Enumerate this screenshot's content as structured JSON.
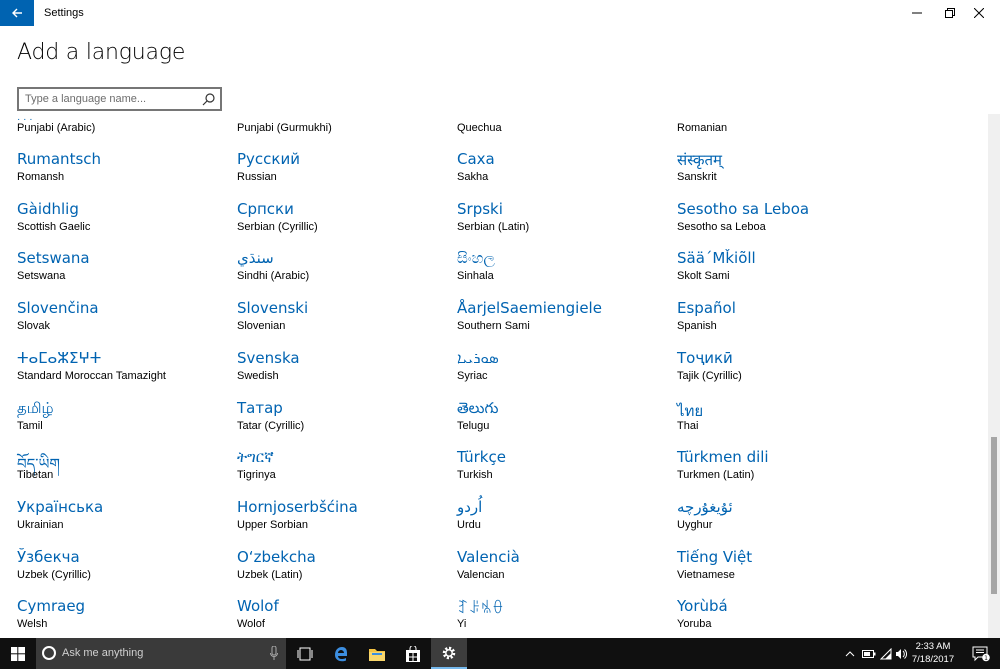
{
  "window": {
    "title": "Settings",
    "back_label": "Back",
    "minimize_label": "Minimize",
    "maximize_label": "Maximize",
    "close_label": "Close"
  },
  "page": {
    "title": "Add a language"
  },
  "search": {
    "placeholder": "Type a language name...",
    "value": ""
  },
  "languages": {
    "rows": [
      [
        {
          "native": "",
          "english": "Punjabi (Arabic)"
        },
        {
          "native": "",
          "english": "Punjabi (Gurmukhi)"
        },
        {
          "native": "",
          "english": "Quechua"
        },
        {
          "native": "",
          "english": "Romanian"
        }
      ],
      [
        {
          "native": "Rumantsch",
          "english": "Romansh"
        },
        {
          "native": "Русский",
          "english": "Russian"
        },
        {
          "native": "Саха",
          "english": "Sakha"
        },
        {
          "native": "संस्कृतम्",
          "english": "Sanskrit"
        }
      ],
      [
        {
          "native": "Gàidhlig",
          "english": "Scottish Gaelic"
        },
        {
          "native": "Српски",
          "english": "Serbian (Cyrillic)"
        },
        {
          "native": "Srpski",
          "english": "Serbian (Latin)"
        },
        {
          "native": "Sesotho sa Leboa",
          "english": "Sesotho sa Leboa"
        }
      ],
      [
        {
          "native": "Setswana",
          "english": "Setswana"
        },
        {
          "native": "سنڌي",
          "english": "Sindhi (Arabic)"
        },
        {
          "native": "සිංහල",
          "english": "Sinhala"
        },
        {
          "native": "Sää´Mǩiõll",
          "english": "Skolt Sami"
        }
      ],
      [
        {
          "native": "Slovenčina",
          "english": "Slovak"
        },
        {
          "native": "Slovenski",
          "english": "Slovenian"
        },
        {
          "native": "ÅarjelSaemiengiele",
          "english": "Southern Sami"
        },
        {
          "native": "Español",
          "english": "Spanish"
        }
      ],
      [
        {
          "native": "ⵜⴰⵎⴰⵣⵉⵖⵜ",
          "english": "Standard Moroccan Tamazight"
        },
        {
          "native": "Svenska",
          "english": "Swedish"
        },
        {
          "native": "ܣܘܪܝܝܐ",
          "english": "Syriac"
        },
        {
          "native": "Тоҷикӣ",
          "english": "Tajik (Cyrillic)"
        }
      ],
      [
        {
          "native": "தமிழ்",
          "english": "Tamil"
        },
        {
          "native": "Татар",
          "english": "Tatar (Cyrillic)"
        },
        {
          "native": "తెలుగు",
          "english": "Telugu"
        },
        {
          "native": "ไทย",
          "english": "Thai"
        }
      ],
      [
        {
          "native": "བོད་ཡིག",
          "english": "Tibetan"
        },
        {
          "native": "ትግርኛ",
          "english": "Tigrinya"
        },
        {
          "native": "Türkçe",
          "english": "Turkish"
        },
        {
          "native": "Türkmen dili",
          "english": "Turkmen (Latin)"
        }
      ],
      [
        {
          "native": "Українська",
          "english": "Ukrainian"
        },
        {
          "native": "Hornjoserbšćina",
          "english": "Upper Sorbian"
        },
        {
          "native": "اُردو",
          "english": "Urdu"
        },
        {
          "native": "ئۇيغۇرچە",
          "english": "Uyghur"
        }
      ],
      [
        {
          "native": "Ўзбекча",
          "english": "Uzbek (Cyrillic)"
        },
        {
          "native": "O‘zbekcha",
          "english": "Uzbek (Latin)"
        },
        {
          "native": "Valencià",
          "english": "Valencian"
        },
        {
          "native": "Tiếng Việt",
          "english": "Vietnamese"
        }
      ],
      [
        {
          "native": "Cymraeg",
          "english": "Welsh"
        },
        {
          "native": "Wolof",
          "english": "Wolof"
        },
        {
          "native": "ꆈꌠꁱꂷ",
          "english": "Yi"
        },
        {
          "native": "Yorùbá",
          "english": "Yoruba"
        }
      ]
    ]
  },
  "scrollbar": {
    "position_fraction": 0.88,
    "visible_fraction": 0.3
  },
  "taskbar": {
    "search_placeholder": "Ask me anything",
    "clock_time": "2:33 AM",
    "clock_date": "7/18/2017",
    "notification_count": "1"
  },
  "colors": {
    "accent": "#0063b1",
    "taskbar": "#101010",
    "taskbar_search": "#3a3a3a"
  }
}
